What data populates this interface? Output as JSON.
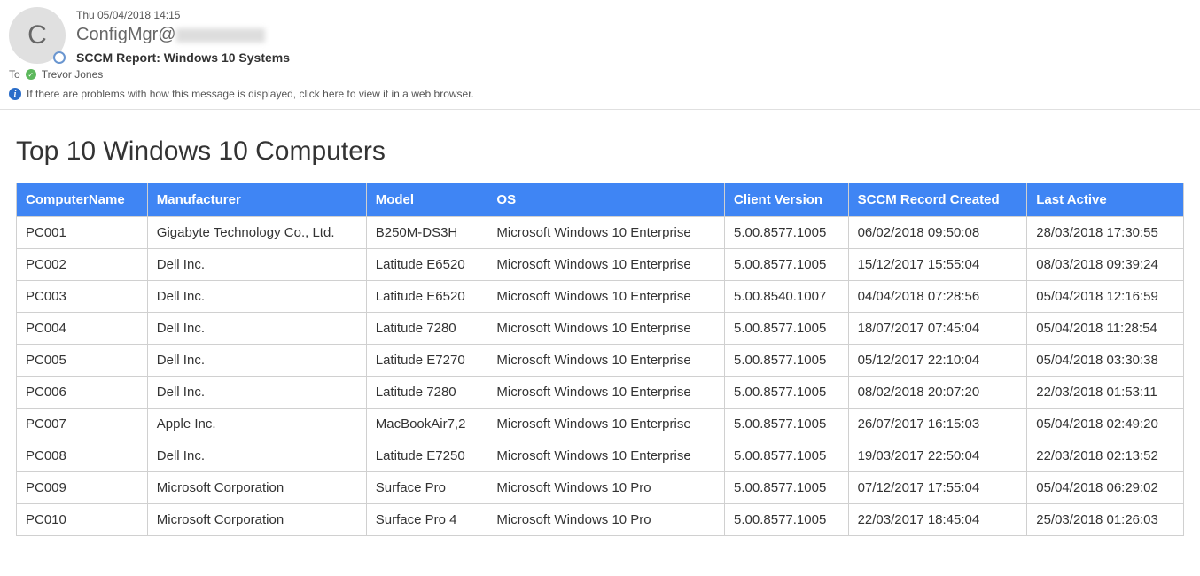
{
  "header": {
    "date": "Thu 05/04/2018 14:15",
    "from_prefix": "ConfigMgr@",
    "subject": "SCCM Report: Windows 10 Systems",
    "avatar_letter": "C",
    "to_label": "To",
    "to_name": "Trevor Jones",
    "info_text": "If there are problems with how this message is displayed, click here to view it in a web browser."
  },
  "report": {
    "title": "Top 10 Windows 10 Computers",
    "columns": [
      "ComputerName",
      "Manufacturer",
      "Model",
      "OS",
      "Client Version",
      "SCCM Record Created",
      "Last Active"
    ],
    "rows": [
      {
        "c0": "PC001",
        "c1": "Gigabyte Technology Co., Ltd.",
        "c2": "B250M-DS3H",
        "c3": "Microsoft Windows 10 Enterprise",
        "c4": "5.00.8577.1005",
        "c5": "06/02/2018 09:50:08",
        "c6": "28/03/2018 17:30:55"
      },
      {
        "c0": "PC002",
        "c1": "Dell Inc.",
        "c2": "Latitude E6520",
        "c3": "Microsoft Windows 10 Enterprise",
        "c4": "5.00.8577.1005",
        "c5": "15/12/2017 15:55:04",
        "c6": "08/03/2018 09:39:24"
      },
      {
        "c0": "PC003",
        "c1": "Dell Inc.",
        "c2": "Latitude E6520",
        "c3": "Microsoft Windows 10 Enterprise",
        "c4": "5.00.8540.1007",
        "c5": "04/04/2018 07:28:56",
        "c6": "05/04/2018 12:16:59"
      },
      {
        "c0": "PC004",
        "c1": "Dell Inc.",
        "c2": "Latitude 7280",
        "c3": "Microsoft Windows 10 Enterprise",
        "c4": "5.00.8577.1005",
        "c5": "18/07/2017 07:45:04",
        "c6": "05/04/2018 11:28:54"
      },
      {
        "c0": "PC005",
        "c1": "Dell Inc.",
        "c2": "Latitude E7270",
        "c3": "Microsoft Windows 10 Enterprise",
        "c4": "5.00.8577.1005",
        "c5": "05/12/2017 22:10:04",
        "c6": "05/04/2018 03:30:38"
      },
      {
        "c0": "PC006",
        "c1": "Dell Inc.",
        "c2": "Latitude 7280",
        "c3": "Microsoft Windows 10 Enterprise",
        "c4": "5.00.8577.1005",
        "c5": "08/02/2018 20:07:20",
        "c6": "22/03/2018 01:53:11"
      },
      {
        "c0": "PC007",
        "c1": "Apple Inc.",
        "c2": "MacBookAir7,2",
        "c3": "Microsoft Windows 10 Enterprise",
        "c4": "5.00.8577.1005",
        "c5": "26/07/2017 16:15:03",
        "c6": "05/04/2018 02:49:20"
      },
      {
        "c0": "PC008",
        "c1": "Dell Inc.",
        "c2": "Latitude E7250",
        "c3": "Microsoft Windows 10 Enterprise",
        "c4": "5.00.8577.1005",
        "c5": "19/03/2017 22:50:04",
        "c6": "22/03/2018 02:13:52"
      },
      {
        "c0": "PC009",
        "c1": "Microsoft Corporation",
        "c2": "Surface Pro",
        "c3": "Microsoft Windows 10 Pro",
        "c4": "5.00.8577.1005",
        "c5": "07/12/2017 17:55:04",
        "c6": "05/04/2018 06:29:02"
      },
      {
        "c0": "PC010",
        "c1": "Microsoft Corporation",
        "c2": "Surface Pro 4",
        "c3": "Microsoft Windows 10 Pro",
        "c4": "5.00.8577.1005",
        "c5": "22/03/2017 18:45:04",
        "c6": "25/03/2018 01:26:03"
      }
    ]
  }
}
